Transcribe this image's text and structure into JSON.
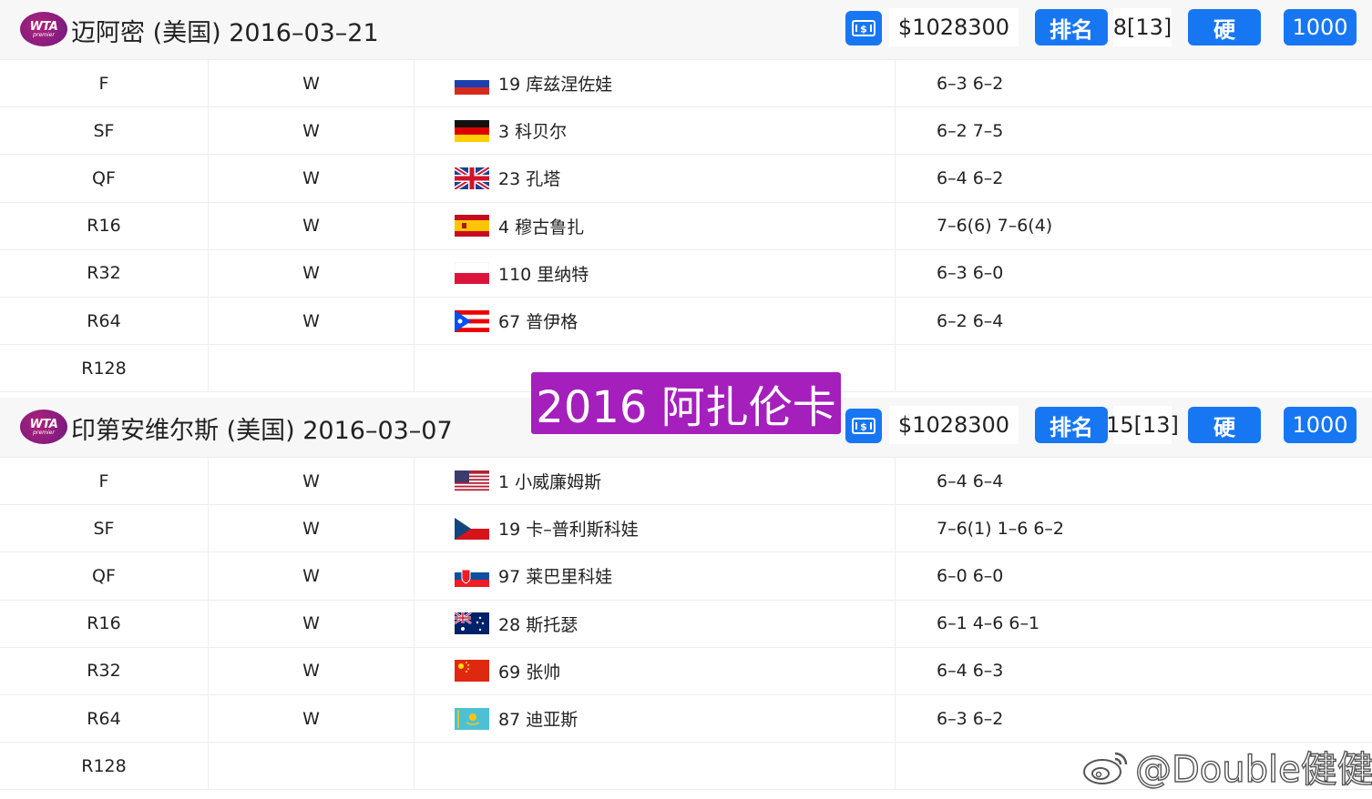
{
  "colors": {
    "accent": "#1777f2",
    "overlay": "#a51fbd",
    "logo": "#8b1d80"
  },
  "tournaments": [
    {
      "logo": {
        "main": "WTA",
        "sub": "premier"
      },
      "title": "迈阿密 (美国) 2016–03–21",
      "prize": "$1028300",
      "rank_label": "排名",
      "rank": "8[13]",
      "surface": "硬",
      "points": "1000",
      "matches": [
        {
          "round": "F",
          "result": "W",
          "flag": "russia",
          "opponent": "19 库兹涅佐娃",
          "score": "6–3 6–2"
        },
        {
          "round": "SF",
          "result": "W",
          "flag": "germany",
          "opponent": "3 科贝尔",
          "score": "6–2 7–5"
        },
        {
          "round": "QF",
          "result": "W",
          "flag": "uk",
          "opponent": "23 孔塔",
          "score": "6–4 6–2"
        },
        {
          "round": "R16",
          "result": "W",
          "flag": "spain",
          "opponent": "4 穆古鲁扎",
          "score": "7–6(6) 7–6(4)"
        },
        {
          "round": "R32",
          "result": "W",
          "flag": "poland",
          "opponent": "110 里纳特",
          "score": "6–3 6–0"
        },
        {
          "round": "R64",
          "result": "W",
          "flag": "puerto-rico",
          "opponent": "67 普伊格",
          "score": "6–2 6–4"
        },
        {
          "round": "R128",
          "result": "",
          "flag": "",
          "opponent": "",
          "score": ""
        }
      ]
    },
    {
      "logo": {
        "main": "WTA",
        "sub": "premier"
      },
      "title": "印第安维尔斯 (美国) 2016–03–07",
      "prize": "$1028300",
      "rank_label": "排名",
      "rank": "15[13]",
      "surface": "硬",
      "points": "1000",
      "matches": [
        {
          "round": "F",
          "result": "W",
          "flag": "usa",
          "opponent": "1 小威廉姆斯",
          "score": "6–4 6–4"
        },
        {
          "round": "SF",
          "result": "W",
          "flag": "czech",
          "opponent": "19 卡–普利斯科娃",
          "score": "7–6(1) 1–6 6–2"
        },
        {
          "round": "QF",
          "result": "W",
          "flag": "slovakia",
          "opponent": "97 莱巴里科娃",
          "score": "6–0 6–0"
        },
        {
          "round": "R16",
          "result": "W",
          "flag": "australia",
          "opponent": "28 斯托瑟",
          "score": "6–1 4–6 6–1"
        },
        {
          "round": "R32",
          "result": "W",
          "flag": "china",
          "opponent": "69 张帅",
          "score": "6–4 6–3"
        },
        {
          "round": "R64",
          "result": "W",
          "flag": "kazakhstan",
          "opponent": "87 迪亚斯",
          "score": "6–3 6–2"
        },
        {
          "round": "R128",
          "result": "",
          "flag": "",
          "opponent": "",
          "score": ""
        }
      ]
    }
  ],
  "overlay_title": "2016 阿扎伦卡",
  "watermark": "@Double健健"
}
